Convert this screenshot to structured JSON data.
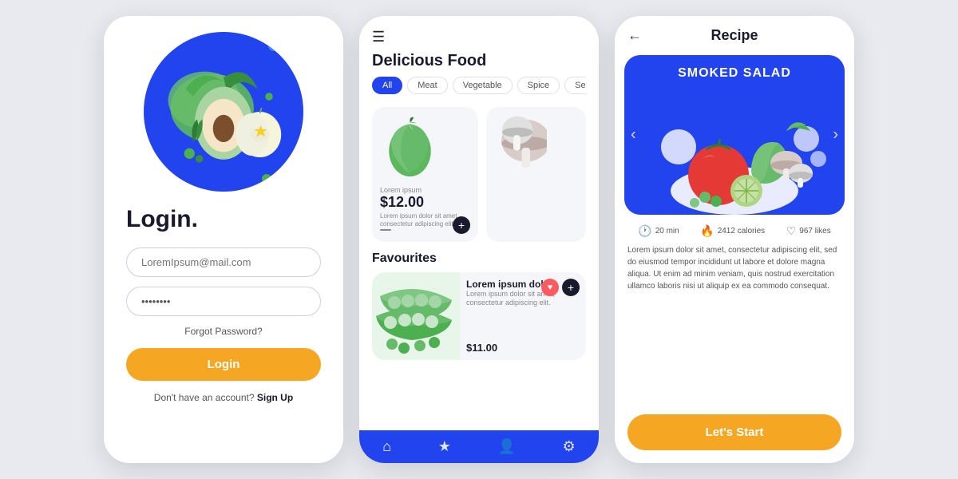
{
  "login": {
    "title": "Login.",
    "email_placeholder": "LoremIpsum@mail.com",
    "password_placeholder": "••••••••",
    "forgot_password": "Forgot Password?",
    "login_button": "Login",
    "signup_text": "Don't have an account?",
    "signup_link": " Sign Up"
  },
  "food": {
    "menu_icon": "☰",
    "title": "Delicious Food",
    "filters": [
      "All",
      "Meat",
      "Vegetable",
      "Spice",
      "Sea..."
    ],
    "products": [
      {
        "label": "Lorem ipsum",
        "price": "$12.00",
        "desc": "Lorem ipsum dolor sit amet, consectetur adipiscing elit."
      }
    ],
    "favourites_title": "Favourites",
    "fav_item": {
      "name": "Lorem ipsum dolor.",
      "desc": "Lorem ipsum dolor sit amet, consectetur adipiscing elit.",
      "price": "$11.00"
    },
    "nav": [
      "🏠",
      "★",
      "👤",
      "⚙"
    ]
  },
  "recipe": {
    "back_icon": "←",
    "title": "Recipe",
    "hero_title": "SMOKED SALAD",
    "stats": [
      {
        "icon": "🕐",
        "value": "20 min"
      },
      {
        "icon": "🔥",
        "value": "2412 calories"
      },
      {
        "icon": "♡",
        "value": "967 likes"
      }
    ],
    "description": "Lorem ipsum dolor sit amet, consectetur adipiscing elit, sed do eiusmod tempor incididunt ut labore et dolore magna aliqua. Ut enim ad minim veniam, quis nostrud exercitation ullamco laboris nisi ut aliquip ex ea commodo consequat.",
    "cta_button": "Let's Start"
  }
}
